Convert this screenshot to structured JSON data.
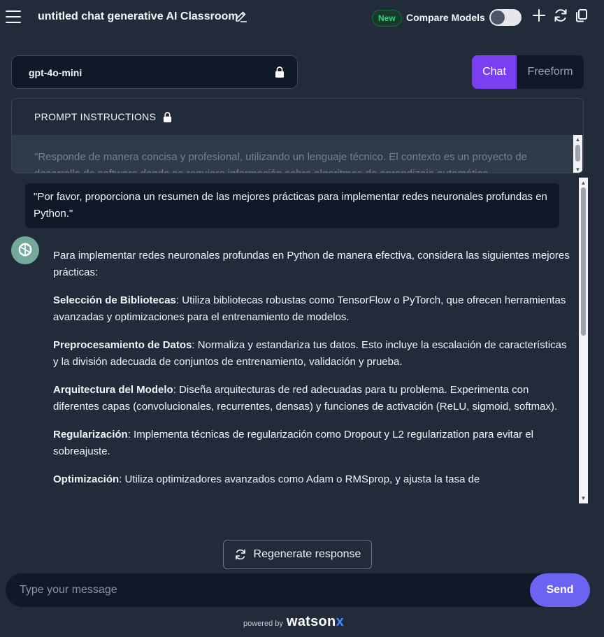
{
  "header": {
    "title": "untitled chat generative AI Classroom",
    "new_badge": "New",
    "compare_label": "Compare Models",
    "compare_enabled": false
  },
  "model": {
    "name": "gpt-4o-mini"
  },
  "mode_tabs": [
    {
      "label": "Chat",
      "active": true
    },
    {
      "label": "Freeform",
      "active": false
    }
  ],
  "prompt": {
    "header": "PROMPT INSTRUCTIONS",
    "text": "\"Responde de manera concisa y profesional, utilizando un lenguaje técnico. El contexto es un proyecto de desarrollo de software donde se requiere información sobre algoritmos de aprendizaje automático."
  },
  "chat": {
    "user_message": "\"Por favor, proporciona un resumen de las mejores prácticas para implementar redes neuronales profundas en Python.\"",
    "assistant": {
      "intro": "Para implementar redes neuronales profundas en Python de manera efectiva, considera las siguientes mejores prácticas:",
      "items": [
        {
          "title": "Selección de Bibliotecas",
          "body": ": Utiliza bibliotecas robustas como TensorFlow o PyTorch, que ofrecen herramientas avanzadas y optimizaciones para el entrenamiento de modelos."
        },
        {
          "title": "Preprocesamiento de Datos",
          "body": ": Normaliza y estandariza tus datos. Esto incluye la escalación de características y la división adecuada de conjuntos de entrenamiento, validación y prueba."
        },
        {
          "title": "Arquitectura del Modelo",
          "body": ": Diseña arquitecturas de red adecuadas para tu problema. Experimenta con diferentes capas (convolucionales, recurrentes, densas) y funciones de activación (ReLU, sigmoid, softmax)."
        },
        {
          "title": "Regularización",
          "body": ": Implementa técnicas de regularización como Dropout y L2 regularization para evitar el sobreajuste."
        },
        {
          "title": "Optimización",
          "body": ": Utiliza optimizadores avanzados como Adam o RMSprop, y ajusta la tasa de"
        }
      ]
    }
  },
  "regenerate_label": "Regenerate response",
  "composer": {
    "placeholder": "Type your message",
    "send_label": "Send"
  },
  "footer": {
    "powered_by": "powered by",
    "brand": "watson",
    "brand_suffix": "x"
  },
  "colors": {
    "background": "#222b3a",
    "panel": "#111827",
    "accent_purple": "#7b3ff2",
    "send_button": "#6c63f0",
    "new_badge_green": "#33d17a",
    "avatar_green": "#74aa9c",
    "watsonx_blue": "#4589ff"
  },
  "icons": {
    "menu": "hamburger-icon",
    "edit": "pencil-icon",
    "add": "plus-icon",
    "refresh": "refresh-icon",
    "copy": "copy-icon",
    "lock": "lock-icon",
    "avatar": "openai-logo-icon"
  }
}
